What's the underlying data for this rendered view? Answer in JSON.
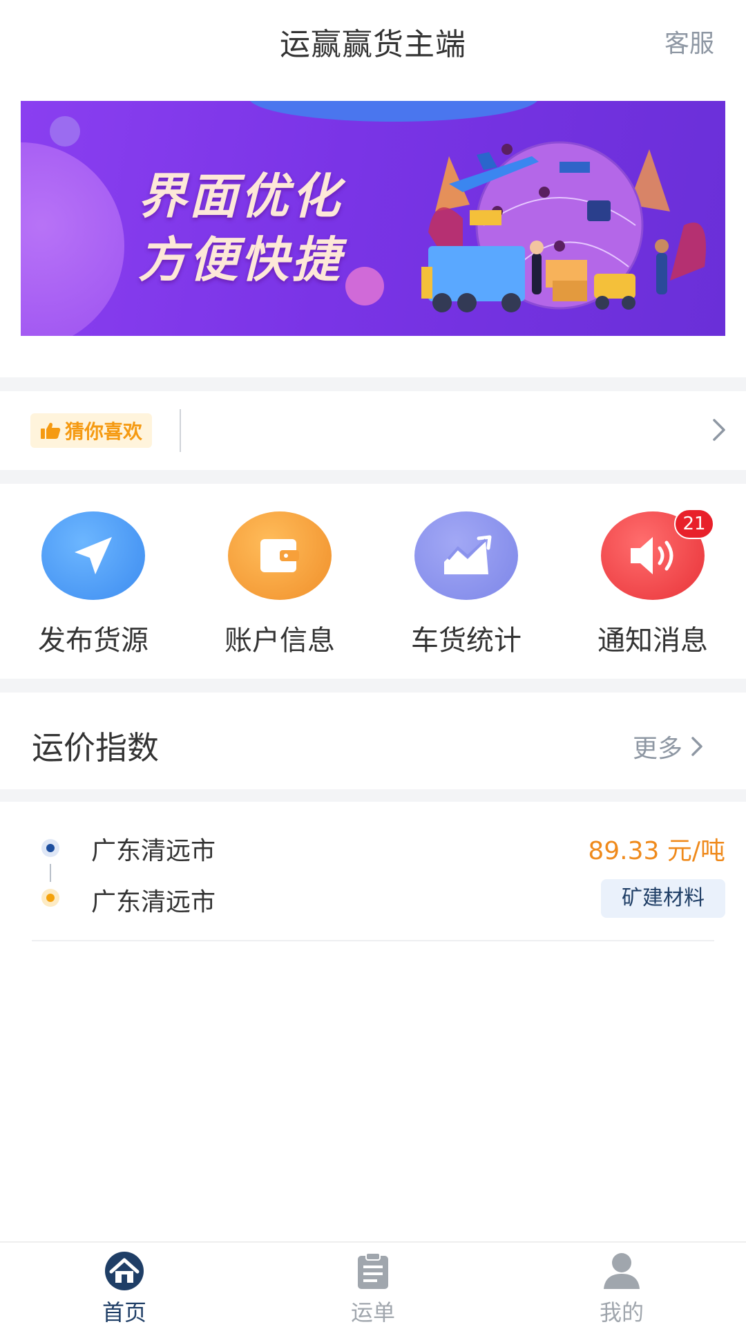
{
  "header": {
    "title": "运赢赢货主端",
    "service_label": "客服"
  },
  "banner": {
    "line1": "界面优化",
    "line2": "方便快捷"
  },
  "guess": {
    "label": "猜你喜欢"
  },
  "menu": {
    "items": [
      {
        "label": "发布货源",
        "icon": "send-icon",
        "color": "#4a9bf2"
      },
      {
        "label": "账户信息",
        "icon": "wallet-icon",
        "color": "#f7a03a"
      },
      {
        "label": "车货统计",
        "icon": "chart-icon",
        "color": "#8a92ec"
      },
      {
        "label": "通知消息",
        "icon": "speaker-icon",
        "color": "#f0494b",
        "badge": "21"
      }
    ]
  },
  "freight_index": {
    "title": "运价指数",
    "more_label": "更多",
    "routes": [
      {
        "from": "广东清远市",
        "to": "广东清远市",
        "price": "89.33 元/吨",
        "cargo": "矿建材料"
      }
    ]
  },
  "tabbar": {
    "active_color": "#1f3e66",
    "inactive_color": "#a0a6ad",
    "tabs": [
      {
        "label": "首页",
        "icon": "home-icon",
        "active": true
      },
      {
        "label": "运单",
        "icon": "clipboard-icon",
        "active": false
      },
      {
        "label": "我的",
        "icon": "user-icon",
        "active": false
      }
    ]
  }
}
